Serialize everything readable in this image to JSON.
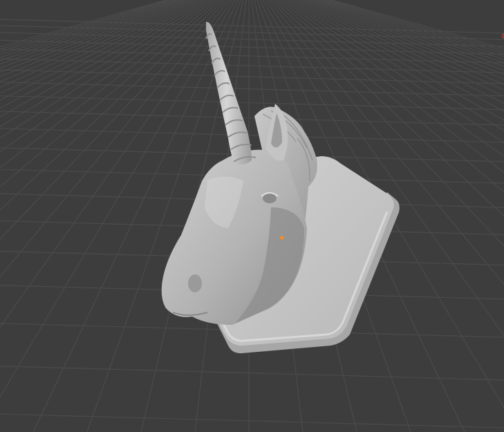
{
  "viewport": {
    "background_color": "#3d3d3d",
    "grid_color": "#4b4b4b",
    "object_color": "#bdbdbd",
    "object_shadow_color": "#8e8e8e",
    "plaque_color": "#c9c9c9",
    "plaque_edge_color": "#aeaeae",
    "origin_color": "#ff8a1f",
    "gizmo_hint_color": "#d8423a"
  },
  "scene": {
    "object": "unicorn-head-trophy-mount",
    "icons": [
      "object-origin-icon",
      "axis-gizmo-edge-icon"
    ]
  }
}
